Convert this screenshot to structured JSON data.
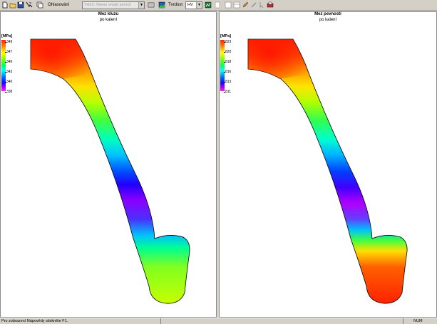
{
  "toolbar": {
    "buttons": [
      "new-icon",
      "open-icon",
      "save-icon",
      "help-icon",
      "copy-icon"
    ],
    "label_mode": "Ohlasování",
    "mode_value": "TH23: Teleso vnejší povrch",
    "label_hardness": "Tvrdost",
    "hardness_value": "HV"
  },
  "left_panel": {
    "title": "Mez kluzu",
    "subtitle": "po kalení",
    "legend": {
      "unit": "[MPa]",
      "ticks": [
        "349",
        "347",
        "346",
        "343",
        "340",
        "338"
      ]
    }
  },
  "right_panel": {
    "title": "Mez pevnosti",
    "subtitle": "po kalení",
    "legend": {
      "unit": "[MPa]",
      "ticks": [
        "823",
        "820",
        "818",
        "816",
        "813",
        "811"
      ]
    }
  },
  "status": {
    "message": "Pro zobrazení Nápovědy stiskněte F1.",
    "num": "NUM"
  }
}
